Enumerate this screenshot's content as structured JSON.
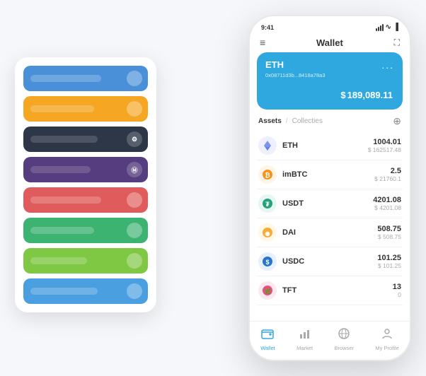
{
  "scene": {
    "background": "#f5f7fa"
  },
  "cardStack": {
    "cards": [
      {
        "color": "#4a90d9",
        "barColor": "#ffffff",
        "dotLabel": ""
      },
      {
        "color": "#f5a623",
        "barColor": "#ffffff",
        "dotLabel": ""
      },
      {
        "color": "#2d3748",
        "barColor": "#ffffff",
        "dotLabel": ""
      },
      {
        "color": "#553d7f",
        "barColor": "#ffffff",
        "dotLabel": ""
      },
      {
        "color": "#e05c5c",
        "barColor": "#ffffff",
        "dotLabel": ""
      },
      {
        "color": "#3cb371",
        "barColor": "#ffffff",
        "dotLabel": ""
      },
      {
        "color": "#7ec843",
        "barColor": "#ffffff",
        "dotLabel": ""
      },
      {
        "color": "#4a9fe0",
        "barColor": "#ffffff",
        "dotLabel": ""
      }
    ]
  },
  "phone": {
    "statusBar": {
      "time": "9:41",
      "signal": "▐▐▐",
      "wifi": "WiFi",
      "battery": "🔋"
    },
    "navBar": {
      "menuIcon": "≡",
      "title": "Wallet",
      "expandIcon": "⛶"
    },
    "ethCard": {
      "label": "ETH",
      "moreIcon": "...",
      "address": "0x08711d3b...8418a78a3",
      "copyIcon": "⊡",
      "currencySymbol": "$",
      "amount": "189,089.11"
    },
    "assetsSection": {
      "activeTab": "Assets",
      "separator": "/",
      "inactiveTab": "Collecties",
      "addIcon": "⊕"
    },
    "assets": [
      {
        "symbol": "ETH",
        "name": "ETH",
        "iconColor": "#627eea",
        "iconEmoji": "◆",
        "amount": "1004.01",
        "usd": "$ 162517.48"
      },
      {
        "symbol": "imBTC",
        "name": "imBTC",
        "iconColor": "#f7931a",
        "iconEmoji": "₿",
        "amount": "2.5",
        "usd": "$ 21760.1"
      },
      {
        "symbol": "USDT",
        "name": "USDT",
        "iconColor": "#26a17b",
        "iconEmoji": "₮",
        "amount": "4201.08",
        "usd": "$ 4201.08"
      },
      {
        "symbol": "DAI",
        "name": "DAI",
        "iconColor": "#f5ac37",
        "iconEmoji": "◉",
        "amount": "508.75",
        "usd": "$ 508.75"
      },
      {
        "symbol": "USDC",
        "name": "USDC",
        "iconColor": "#2775ca",
        "iconEmoji": "©",
        "amount": "101.25",
        "usd": "$ 101.25"
      },
      {
        "symbol": "TFT",
        "name": "TFT",
        "iconColor": "#e8507e",
        "iconEmoji": "🌿",
        "amount": "13",
        "usd": "0"
      }
    ],
    "bottomNav": [
      {
        "label": "Wallet",
        "icon": "◎",
        "active": true
      },
      {
        "label": "Market",
        "icon": "📊",
        "active": false
      },
      {
        "label": "Browser",
        "icon": "👤",
        "active": false
      },
      {
        "label": "My Profile",
        "icon": "👤",
        "active": false
      }
    ]
  }
}
